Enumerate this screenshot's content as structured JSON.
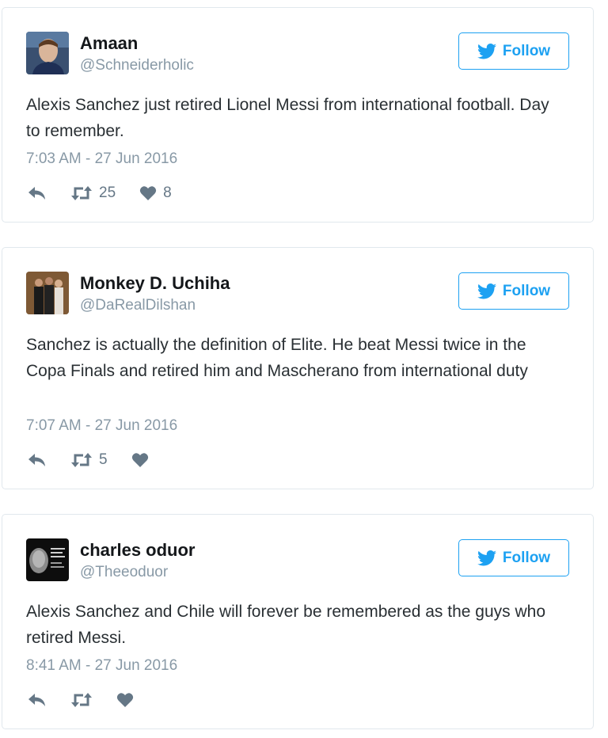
{
  "follow_label": "Follow",
  "tweets": [
    {
      "name": "Amaan",
      "handle": "@Schneiderholic",
      "text": "Alexis Sanchez just retired Lionel Messi from international football. Day to remember.",
      "timestamp": "7:03 AM - 27 Jun 2016",
      "retweets": "25",
      "likes": "8"
    },
    {
      "name": "Monkey D. Uchiha",
      "handle": "@DaRealDilshan",
      "text": "Sanchez is actually the definition of Elite. He beat Messi twice in the Copa Finals and retired him and Mascherano from international duty",
      "timestamp": "7:07 AM - 27 Jun 2016",
      "retweets": "5",
      "likes": ""
    },
    {
      "name": "charles oduor",
      "handle": "@Theeoduor",
      "text": "Alexis Sanchez and Chile will forever be remembered as the guys who retired Messi.",
      "timestamp": "8:41 AM - 27 Jun 2016",
      "retweets": "",
      "likes": ""
    }
  ],
  "icons": {
    "follow": "twitter-bird-icon",
    "reply": "reply-icon",
    "retweet": "retweet-icon",
    "like": "heart-icon"
  },
  "colors": {
    "accent": "#1da1f2",
    "action_gray": "#657786",
    "meta_gray": "#8899a6",
    "border": "#e1e8ed"
  }
}
